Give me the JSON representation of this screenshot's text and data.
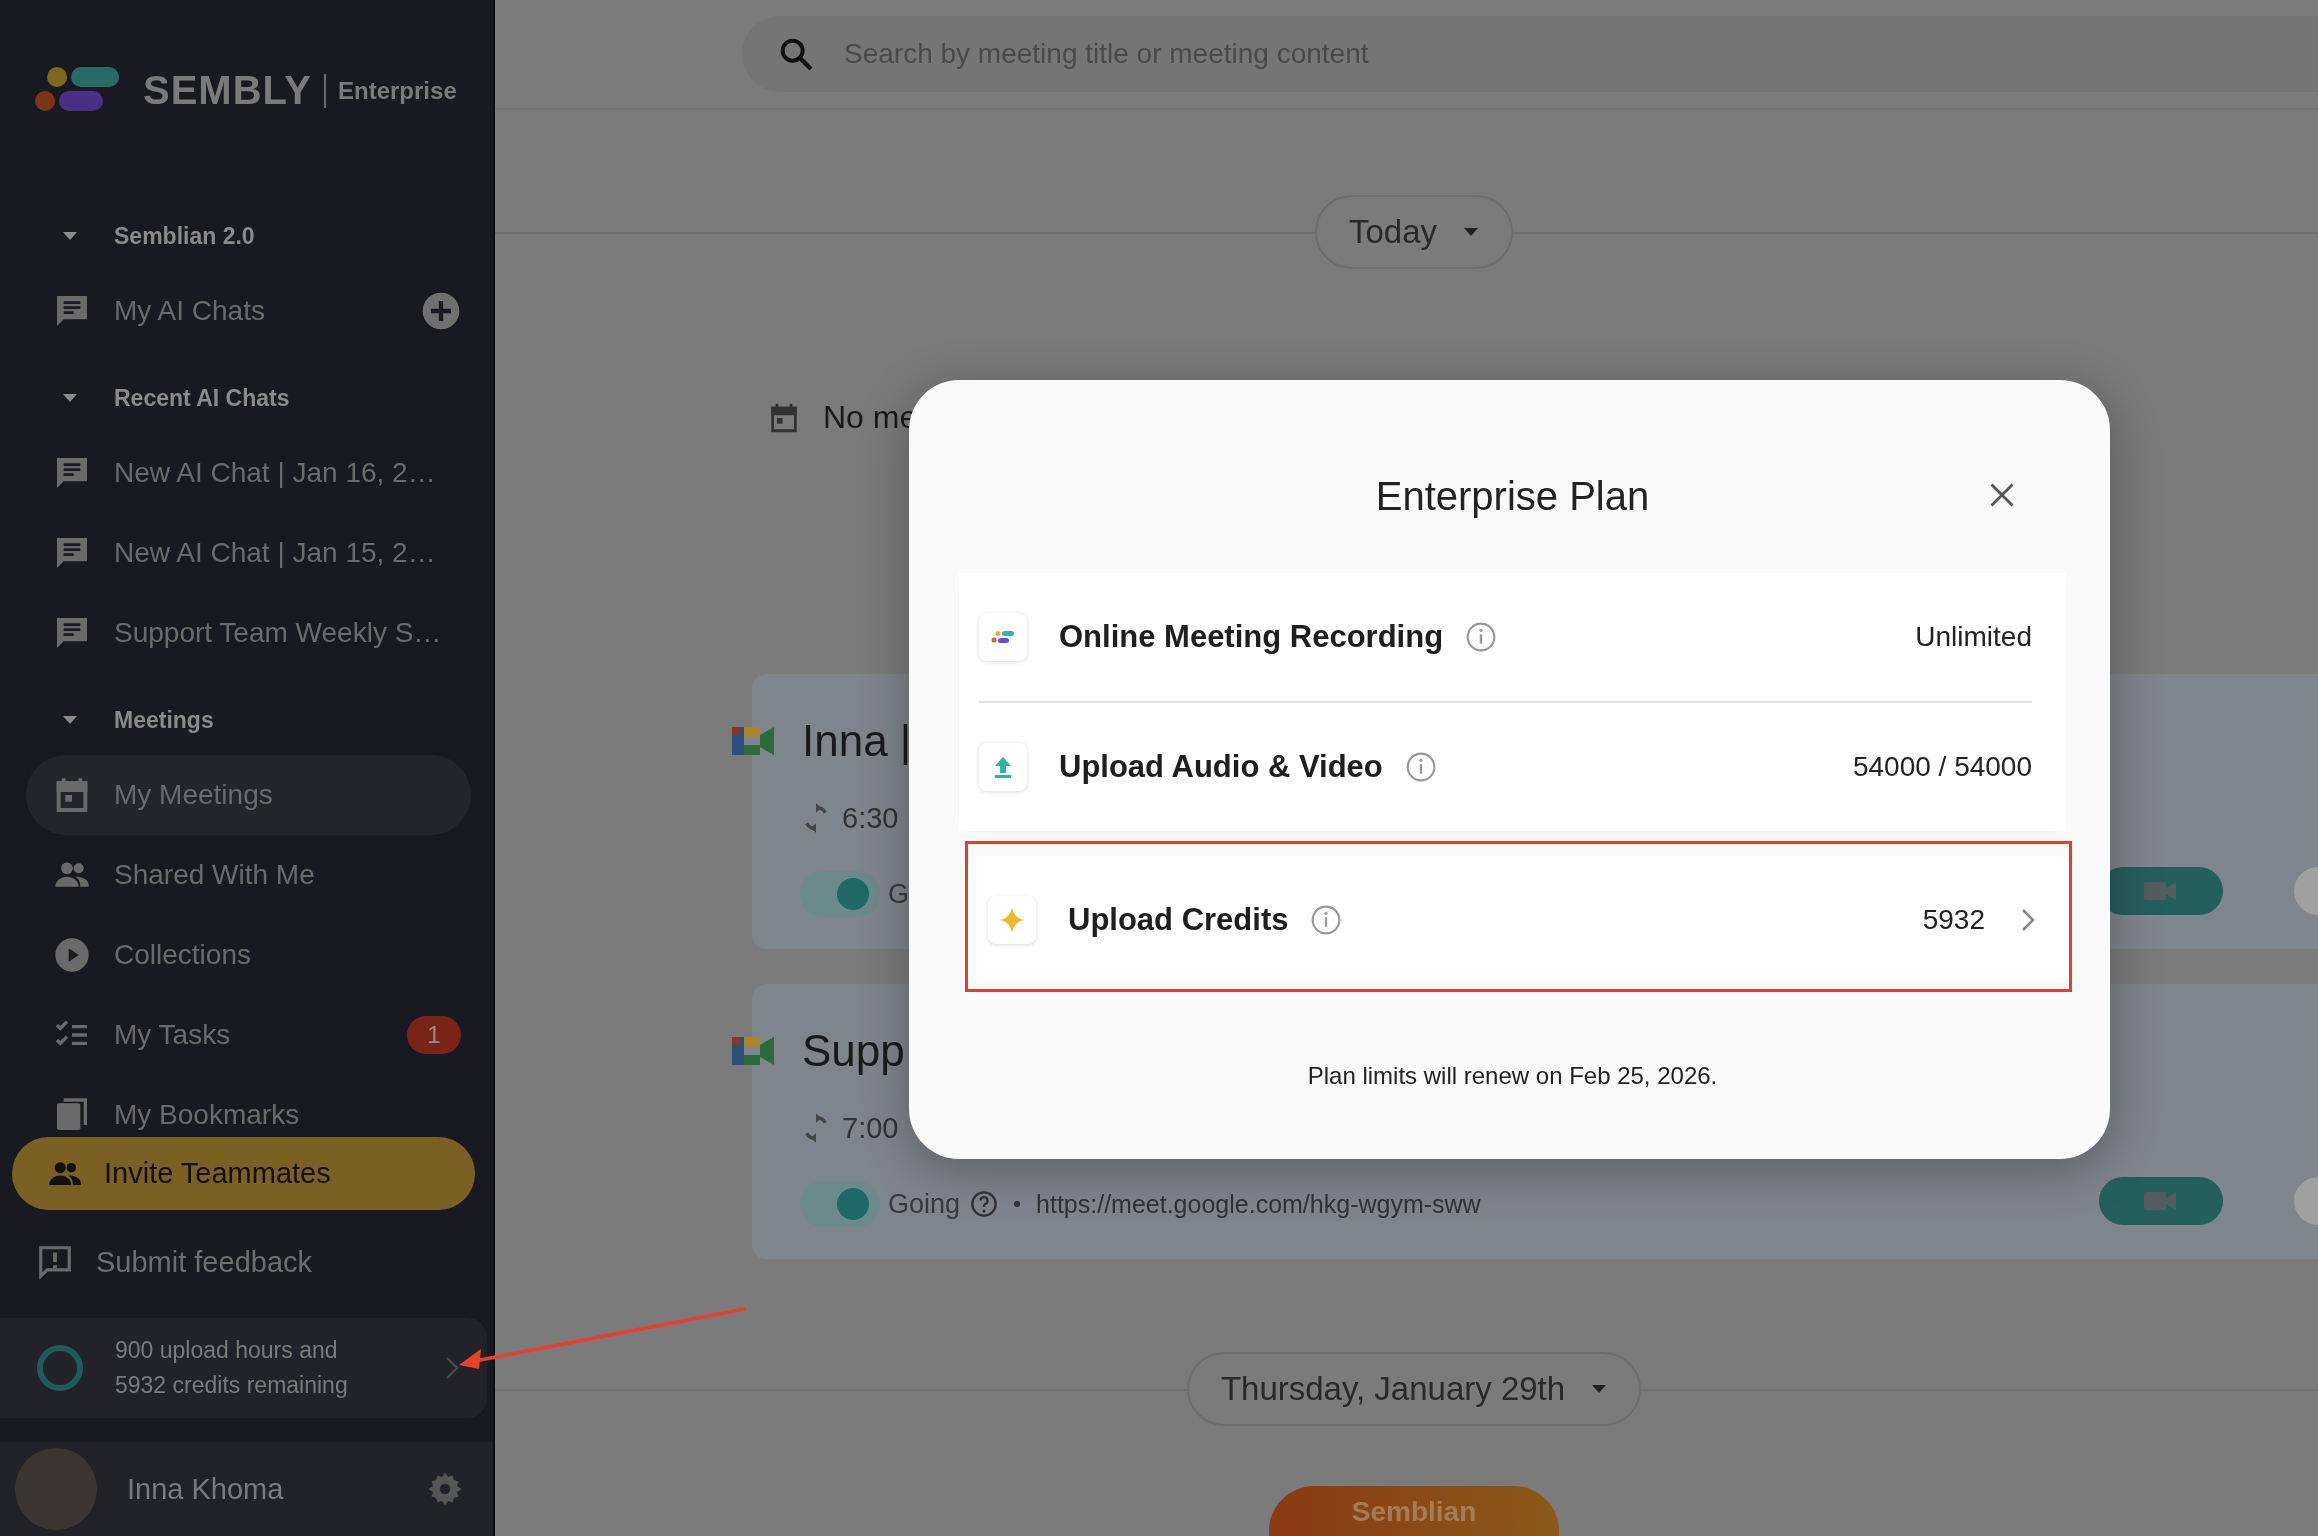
{
  "sidebar": {
    "logo": {
      "wordmark": "SEMBLY",
      "edition": "Enterprise"
    },
    "sections": [
      {
        "title": "Semblian 2.0",
        "expanded": true,
        "items": [
          {
            "label": "My AI Chats",
            "selected": false,
            "add_button": true
          }
        ]
      },
      {
        "title": "Recent AI Chats",
        "expanded": true,
        "items": [
          {
            "label": "New AI Chat | Jan 16, 2…",
            "selected": false
          },
          {
            "label": "New AI Chat | Jan 15, 2…",
            "selected": false
          },
          {
            "label": "Support Team Weekly S…",
            "selected": false
          }
        ]
      },
      {
        "title": "Meetings",
        "expanded": true,
        "items": [
          {
            "label": "My Meetings",
            "selected": true
          },
          {
            "label": "Shared With Me",
            "selected": false
          },
          {
            "label": "Collections",
            "selected": false
          },
          {
            "label": "My Tasks",
            "selected": false,
            "badge": "1"
          },
          {
            "label": "My Bookmarks",
            "selected": false
          }
        ]
      }
    ],
    "invite_button": "Invite Teammates",
    "feedback_link": "Submit feedback",
    "usage": {
      "lines": [
        "900 upload hours and",
        "5932 credits remaining"
      ]
    },
    "user": {
      "name": "Inna Khoma"
    }
  },
  "main": {
    "search": {
      "placeholder": "Search by meeting title or meeting content"
    },
    "day_selectors": [
      "Today",
      "Thursday, January 29th"
    ],
    "empty_note": "No me",
    "meetings": [
      {
        "title": "Inna |",
        "time": "6:30",
        "rsvp": "G",
        "going": true
      },
      {
        "title": "Supp",
        "time": "7:00",
        "rsvp": "Going",
        "going": true,
        "link": "https://meet.google.com/hkg-wgym-sww"
      }
    ],
    "semblian_button": "Semblian"
  },
  "modal": {
    "title": "Enterprise Plan",
    "cards": [
      {
        "highlighted": false,
        "rows": [
          {
            "kind": "recording",
            "label": "Online Meeting Recording",
            "value": "Unlimited",
            "chevron": false
          },
          {
            "kind": "upload",
            "label": "Upload Audio & Video",
            "value": "54000 / 54000",
            "chevron": false
          }
        ]
      },
      {
        "highlighted": true,
        "rows": [
          {
            "kind": "credits",
            "label": "Upload Credits",
            "value": "5932",
            "chevron": true
          }
        ]
      }
    ],
    "footer": "Plan limits will renew on Feb 25, 2026."
  }
}
